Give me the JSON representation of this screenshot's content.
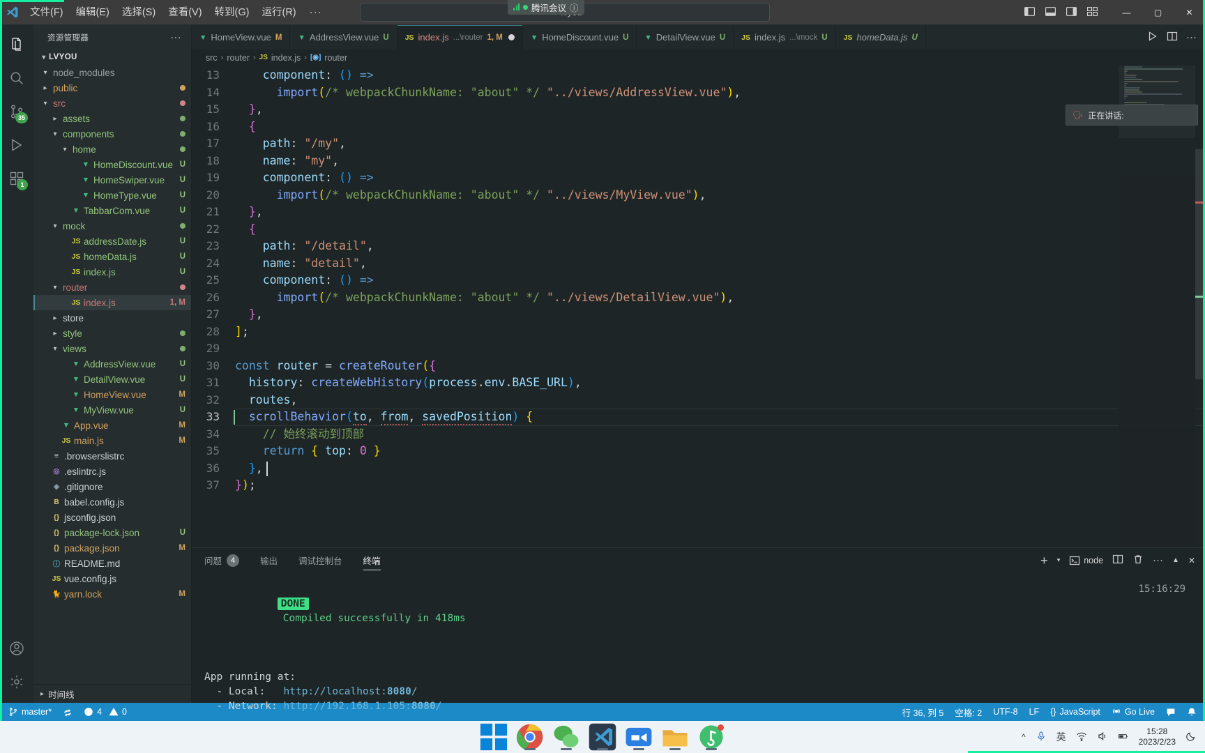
{
  "titlebar": {
    "menu": [
      "文件(F)",
      "编辑(E)",
      "选择(S)",
      "查看(V)",
      "转到(G)",
      "运行(R)"
    ],
    "menu_more": "···",
    "quick_open_value": "lvyou",
    "meeting_overlay": "腾讯会议",
    "minimize": "—",
    "maximize": "▢",
    "close": "✕"
  },
  "activitybar": {
    "items": [
      {
        "name": "explorer",
        "badge": ""
      },
      {
        "name": "search",
        "badge": ""
      },
      {
        "name": "source-control",
        "badge": "35"
      },
      {
        "name": "run-debug",
        "badge": ""
      },
      {
        "name": "extensions",
        "badge": "1"
      }
    ],
    "accounts": "accounts",
    "settings": "settings"
  },
  "sidebar": {
    "title": "资源管理器",
    "more": "···",
    "footer": "时间线",
    "root": "LVYOU",
    "tree": [
      {
        "indent": 0,
        "twisty": "▾",
        "icon": "",
        "name": "node_modules",
        "meta": "",
        "color": "c-grey",
        "iconcolor": "",
        "kind": "folder-collapsed"
      },
      {
        "indent": 0,
        "twisty": "▸",
        "icon": "",
        "name": "public",
        "meta": "●",
        "color": "c-orange",
        "kind": "folder"
      },
      {
        "indent": 0,
        "twisty": "▾",
        "icon": "",
        "name": "src",
        "meta": "●",
        "color": "c-red",
        "kind": "folder"
      },
      {
        "indent": 1,
        "twisty": "▸",
        "icon": "",
        "name": "assets",
        "meta": "●",
        "color": "c-green",
        "kind": "folder"
      },
      {
        "indent": 1,
        "twisty": "▾",
        "icon": "",
        "name": "components",
        "meta": "●",
        "color": "c-green",
        "kind": "folder"
      },
      {
        "indent": 2,
        "twisty": "▾",
        "icon": "",
        "name": "home",
        "meta": "●",
        "color": "c-green",
        "kind": "folder"
      },
      {
        "indent": 3,
        "twisty": "",
        "icon": "V",
        "name": "HomeDiscount.vue",
        "meta": "U",
        "color": "c-green",
        "kind": "vue"
      },
      {
        "indent": 3,
        "twisty": "",
        "icon": "V",
        "name": "HomeSwiper.vue",
        "meta": "U",
        "color": "c-green",
        "kind": "vue"
      },
      {
        "indent": 3,
        "twisty": "",
        "icon": "V",
        "name": "HomeType.vue",
        "meta": "U",
        "color": "c-green",
        "kind": "vue"
      },
      {
        "indent": 2,
        "twisty": "",
        "icon": "V",
        "name": "TabbarCom.vue",
        "meta": "U",
        "color": "c-green",
        "kind": "vue"
      },
      {
        "indent": 1,
        "twisty": "▾",
        "icon": "",
        "name": "mock",
        "meta": "●",
        "color": "c-green",
        "kind": "folder"
      },
      {
        "indent": 2,
        "twisty": "",
        "icon": "JS",
        "name": "addressDate.js",
        "meta": "U",
        "color": "c-green",
        "kind": "js"
      },
      {
        "indent": 2,
        "twisty": "",
        "icon": "JS",
        "name": "homeData.js",
        "meta": "U",
        "color": "c-green",
        "kind": "js"
      },
      {
        "indent": 2,
        "twisty": "",
        "icon": "JS",
        "name": "index.js",
        "meta": "U",
        "color": "c-green",
        "kind": "js"
      },
      {
        "indent": 1,
        "twisty": "▾",
        "icon": "",
        "name": "router",
        "meta": "●",
        "color": "c-red",
        "kind": "folder"
      },
      {
        "indent": 2,
        "twisty": "",
        "icon": "JS",
        "name": "index.js",
        "meta": "1, M",
        "color": "c-red",
        "kind": "js",
        "selected": true
      },
      {
        "indent": 1,
        "twisty": "▸",
        "icon": "",
        "name": "store",
        "meta": "",
        "color": "c-white",
        "kind": "folder"
      },
      {
        "indent": 1,
        "twisty": "▸",
        "icon": "",
        "name": "style",
        "meta": "●",
        "color": "c-green",
        "kind": "folder"
      },
      {
        "indent": 1,
        "twisty": "▾",
        "icon": "",
        "name": "views",
        "meta": "●",
        "color": "c-green",
        "kind": "folder"
      },
      {
        "indent": 2,
        "twisty": "",
        "icon": "V",
        "name": "AddressView.vue",
        "meta": "U",
        "color": "c-green",
        "kind": "vue"
      },
      {
        "indent": 2,
        "twisty": "",
        "icon": "V",
        "name": "DetailView.vue",
        "meta": "U",
        "color": "c-green",
        "kind": "vue"
      },
      {
        "indent": 2,
        "twisty": "",
        "icon": "V",
        "name": "HomeView.vue",
        "meta": "M",
        "color": "c-orange",
        "kind": "vue"
      },
      {
        "indent": 2,
        "twisty": "",
        "icon": "V",
        "name": "MyView.vue",
        "meta": "U",
        "color": "c-green",
        "kind": "vue"
      },
      {
        "indent": 1,
        "twisty": "",
        "icon": "V",
        "name": "App.vue",
        "meta": "M",
        "color": "c-orange",
        "kind": "vue"
      },
      {
        "indent": 1,
        "twisty": "",
        "icon": "JS",
        "name": "main.js",
        "meta": "M",
        "color": "c-orange",
        "kind": "js"
      },
      {
        "indent": 0,
        "twisty": "",
        "icon": "≡",
        "name": ".browserslistrc",
        "meta": "",
        "color": "c-white",
        "kind": "cfg"
      },
      {
        "indent": 0,
        "twisty": "",
        "icon": "◎",
        "name": ".eslintrc.js",
        "meta": "",
        "color": "c-white",
        "kind": "eslint"
      },
      {
        "indent": 0,
        "twisty": "",
        "icon": "◈",
        "name": ".gitignore",
        "meta": "",
        "color": "c-white",
        "kind": "git"
      },
      {
        "indent": 0,
        "twisty": "",
        "icon": "B",
        "name": "babel.config.js",
        "meta": "",
        "color": "c-white",
        "kind": "babel"
      },
      {
        "indent": 0,
        "twisty": "",
        "icon": "{}",
        "name": "jsconfig.json",
        "meta": "",
        "color": "c-white",
        "kind": "json"
      },
      {
        "indent": 0,
        "twisty": "",
        "icon": "{}",
        "name": "package-lock.json",
        "meta": "U",
        "color": "c-green",
        "kind": "json"
      },
      {
        "indent": 0,
        "twisty": "",
        "icon": "{}",
        "name": "package.json",
        "meta": "M",
        "color": "c-orange",
        "kind": "json"
      },
      {
        "indent": 0,
        "twisty": "",
        "icon": "ⓘ",
        "name": "README.md",
        "meta": "",
        "color": "c-white",
        "kind": "md"
      },
      {
        "indent": 0,
        "twisty": "",
        "icon": "JS",
        "name": "vue.config.js",
        "meta": "",
        "color": "c-white",
        "kind": "js"
      },
      {
        "indent": 0,
        "twisty": "",
        "icon": "🐈",
        "name": "yarn.lock",
        "meta": "M",
        "color": "c-orange",
        "kind": "yarn"
      }
    ]
  },
  "editor": {
    "tabs": [
      {
        "icon": "V",
        "kind": "vue",
        "label": "HomeView.vue",
        "sub": "",
        "status": "M",
        "active": false,
        "dirty": false,
        "italic": false
      },
      {
        "icon": "V",
        "kind": "vue",
        "label": "AddressView.vue",
        "sub": "",
        "status": "U",
        "active": false,
        "dirty": false,
        "italic": false
      },
      {
        "icon": "JS",
        "kind": "js",
        "label": "index.js",
        "sub": "...\\router",
        "status": "1, M",
        "active": true,
        "dirty": true,
        "italic": false
      },
      {
        "icon": "V",
        "kind": "vue",
        "label": "HomeDiscount.vue",
        "sub": "",
        "status": "U",
        "active": false,
        "dirty": false,
        "italic": false
      },
      {
        "icon": "V",
        "kind": "vue",
        "label": "DetailView.vue",
        "sub": "",
        "status": "U",
        "active": false,
        "dirty": false,
        "italic": false
      },
      {
        "icon": "JS",
        "kind": "js",
        "label": "index.js",
        "sub": "...\\mock",
        "status": "U",
        "active": false,
        "dirty": false,
        "italic": false
      },
      {
        "icon": "JS",
        "kind": "js",
        "label": "homeData.js",
        "sub": "",
        "status": "U",
        "active": false,
        "dirty": false,
        "italic": true
      }
    ],
    "breadcrumb": [
      "src",
      "router",
      "index.js",
      "router"
    ],
    "notification": "正在讲话:",
    "lines": [
      {
        "n": 13,
        "html": "    <span class='t-prop'>component</span><span class='t-punc'>:</span> <span class='t-brace3'>(</span><span class='t-brace3'>)</span> <span class='t-kw'>=&gt;</span>"
      },
      {
        "n": 14,
        "html": "      <span class='t-fn'>import</span><span class='t-brace1'>(</span><span class='t-com'>/* webpackChunkName: \"about\" */</span> <span class='t-str'>\"../views/AddressView.vue\"</span><span class='t-brace1'>)</span><span class='t-punc'>,</span>"
      },
      {
        "n": 15,
        "html": "  <span class='t-brace2'>}</span><span class='t-punc'>,</span>"
      },
      {
        "n": 16,
        "html": "  <span class='t-brace2'>{</span>"
      },
      {
        "n": 17,
        "html": "    <span class='t-prop'>path</span><span class='t-punc'>:</span> <span class='t-str'>\"/my\"</span><span class='t-punc'>,</span>"
      },
      {
        "n": 18,
        "html": "    <span class='t-prop'>name</span><span class='t-punc'>:</span> <span class='t-str'>\"my\"</span><span class='t-punc'>,</span>"
      },
      {
        "n": 19,
        "html": "    <span class='t-prop'>component</span><span class='t-punc'>:</span> <span class='t-brace3'>(</span><span class='t-brace3'>)</span> <span class='t-kw'>=&gt;</span>"
      },
      {
        "n": 20,
        "html": "      <span class='t-fn'>import</span><span class='t-brace1'>(</span><span class='t-com'>/* webpackChunkName: \"about\" */</span> <span class='t-str'>\"../views/MyView.vue\"</span><span class='t-brace1'>)</span><span class='t-punc'>,</span>"
      },
      {
        "n": 21,
        "html": "  <span class='t-brace2'>}</span><span class='t-punc'>,</span>"
      },
      {
        "n": 22,
        "html": "  <span class='t-brace2'>{</span>"
      },
      {
        "n": 23,
        "html": "    <span class='t-prop'>path</span><span class='t-punc'>:</span> <span class='t-str'>\"/detail\"</span><span class='t-punc'>,</span>"
      },
      {
        "n": 24,
        "html": "    <span class='t-prop'>name</span><span class='t-punc'>:</span> <span class='t-str'>\"detail\"</span><span class='t-punc'>,</span>"
      },
      {
        "n": 25,
        "html": "    <span class='t-prop'>component</span><span class='t-punc'>:</span> <span class='t-brace3'>(</span><span class='t-brace3'>)</span> <span class='t-kw'>=&gt;</span>"
      },
      {
        "n": 26,
        "html": "      <span class='t-fn'>import</span><span class='t-brace1'>(</span><span class='t-com'>/* webpackChunkName: \"about\" */</span> <span class='t-str'>\"../views/DetailView.vue\"</span><span class='t-brace1'>)</span><span class='t-punc'>,</span>"
      },
      {
        "n": 27,
        "html": "  <span class='t-brace2'>}</span><span class='t-punc'>,</span>"
      },
      {
        "n": 28,
        "html": "<span class='t-brace1'>]</span><span class='t-punc'>;</span>"
      },
      {
        "n": 29,
        "html": ""
      },
      {
        "n": 30,
        "html": "<span class='t-kw'>const</span> <span class='t-var'>router</span> <span class='t-punc'>=</span> <span class='t-fn'>createRouter</span><span class='t-brace1'>(</span><span class='t-brace2'>{</span>"
      },
      {
        "n": 31,
        "html": "  <span class='t-prop'>history</span><span class='t-punc'>:</span> <span class='t-fn'>createWebHistory</span><span class='t-brace3'>(</span><span class='t-var'>process</span><span class='t-punc'>.</span><span class='t-var'>env</span><span class='t-punc'>.</span><span class='t-prop'>BASE_URL</span><span class='t-brace3'>)</span><span class='t-punc'>,</span>"
      },
      {
        "n": 32,
        "html": "  <span class='t-prop'>routes</span><span class='t-punc'>,</span>"
      },
      {
        "n": 33,
        "html": "  <span class='t-fn'>scrollBehavior</span><span class='t-brace3'>(</span><span class='t-var squiggle'>to</span><span class='t-punc'>,</span> <span class='t-var squiggle'>from</span><span class='t-punc'>,</span> <span class='t-var squiggle'>savedPosition</span><span class='t-brace3'>)</span> <span class='t-brace1'>{</span>",
        "current": true
      },
      {
        "n": 34,
        "html": "    <span class='t-com'>// 始终滚动到顶部</span>"
      },
      {
        "n": 35,
        "html": "    <span class='t-kw'>return</span> <span class='t-brace1'>{</span> <span class='t-prop'>top</span><span class='t-punc'>:</span> <span class='t-brace2'>0</span> <span class='t-brace1'>}</span>"
      },
      {
        "n": 36,
        "html": "  <span class='t-brace3'>}</span><span class='t-punc'>,</span>",
        "cursor": true
      },
      {
        "n": 37,
        "html": "<span class='t-brace2'>}</span><span class='t-brace1'>)</span><span class='t-punc'>;</span>"
      }
    ]
  },
  "panel": {
    "tabs": [
      {
        "label": "问题",
        "count": "4",
        "active": false
      },
      {
        "label": "输出",
        "count": "",
        "active": false
      },
      {
        "label": "调试控制台",
        "count": "",
        "active": false
      },
      {
        "label": "终端",
        "count": "",
        "active": true
      }
    ],
    "terminal_select": "node",
    "terminal": {
      "timestamp": "15:16:29",
      "done_badge": "DONE",
      "done_text": "Compiled successfully in 418ms",
      "app_running": "App running at:",
      "local_label": "  - Local:   ",
      "local_url_pre": "http://localhost:",
      "local_port": "8080",
      "local_url_post": "/",
      "network_label": "  - Network: ",
      "network_url_pre": "http://192.168.1.105:",
      "network_port": "8080",
      "network_url_post": "/"
    }
  },
  "statusbar": {
    "branch": "master*",
    "errors": "4",
    "warnings": "0",
    "line_col": "行 36, 列 5",
    "spaces": "空格: 2",
    "encoding": "UTF-8",
    "eol": "LF",
    "language": "JavaScript",
    "golive": "Go Live"
  },
  "taskbar": {
    "ime": "英",
    "time": "15:28",
    "date": "2023/2/23",
    "apps": [
      "start",
      "chrome",
      "wechat",
      "vscode",
      "tencent-meeting",
      "file-explorer",
      "music"
    ]
  }
}
